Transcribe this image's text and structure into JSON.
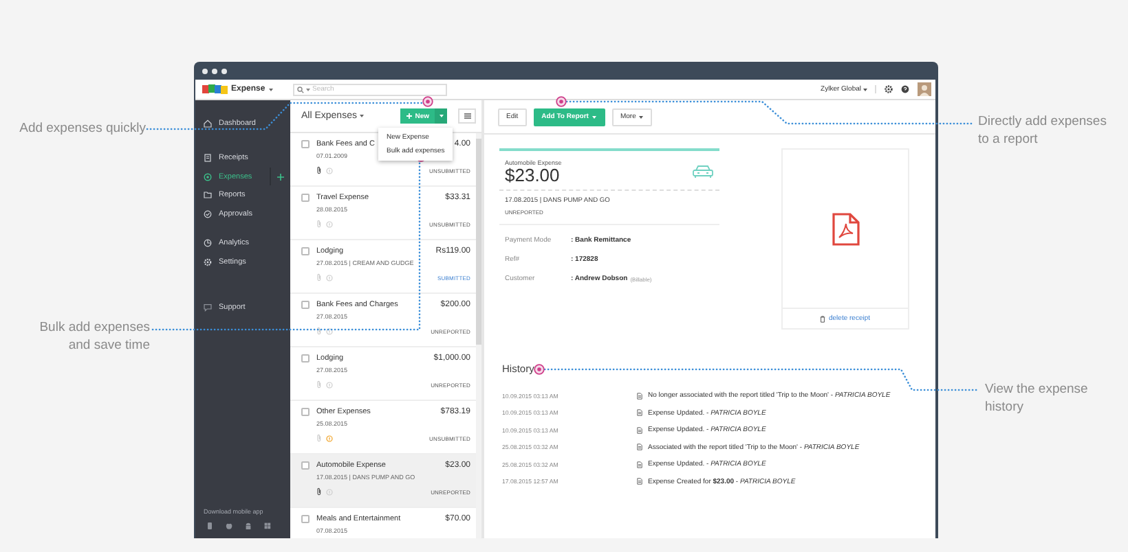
{
  "window": {
    "app_name": "Expense"
  },
  "topbar": {
    "search": {
      "placeholder": "Search"
    },
    "organization": "Zylker Global"
  },
  "sidebar": {
    "sections": [
      [
        {
          "label": "Dashboard",
          "selected": false
        }
      ],
      [
        {
          "label": "Receipts",
          "selected": false
        },
        {
          "label": "Expenses",
          "selected": true,
          "add_button": true
        },
        {
          "label": "Reports",
          "selected": false
        },
        {
          "label": "Approvals",
          "selected": false
        }
      ],
      [
        {
          "label": "Analytics",
          "selected": false
        },
        {
          "label": "Settings",
          "selected": false
        }
      ],
      [
        {
          "label": "Support",
          "selected": false
        }
      ]
    ],
    "footer": "Download mobile app"
  },
  "list": {
    "title": "All Expenses",
    "new_button": "New",
    "menu": [
      "New Expense",
      "Bulk add expenses"
    ],
    "items": [
      {
        "title": "Bank Fees and C",
        "meta": "07.01.2009",
        "amount": "4.00",
        "status": "UNSUBMITTED",
        "submitted": false,
        "checked": false,
        "attached": true,
        "flagged": false,
        "selected": false
      },
      {
        "title": "Travel Expense",
        "meta": "28.08.2015",
        "amount": "$33.31",
        "status": "UNSUBMITTED",
        "submitted": false,
        "checked": false,
        "attached": false,
        "flagged": false,
        "selected": false
      },
      {
        "title": "Lodging",
        "meta": "27.08.2015  |  CREAM AND GUDGE",
        "amount": "Rs119.00",
        "status": "SUBMITTED",
        "submitted": true,
        "checked": false,
        "attached": false,
        "flagged": false,
        "selected": false
      },
      {
        "title": "Bank Fees and Charges",
        "meta": "27.08.2015",
        "amount": "$200.00",
        "status": "UNREPORTED",
        "submitted": false,
        "checked": false,
        "attached": false,
        "flagged": false,
        "selected": false
      },
      {
        "title": "Lodging",
        "meta": "27.08.2015",
        "amount": "$1,000.00",
        "status": "UNREPORTED",
        "submitted": false,
        "checked": false,
        "attached": false,
        "flagged": false,
        "selected": false
      },
      {
        "title": "Other Expenses",
        "meta": "25.08.2015",
        "amount": "$783.19",
        "status": "UNSUBMITTED",
        "submitted": false,
        "checked": false,
        "attached": false,
        "flagged": true,
        "selected": false
      },
      {
        "title": "Automobile Expense",
        "meta": "17.08.2015  |  DANS PUMP AND GO",
        "amount": "$23.00",
        "status": "UNREPORTED",
        "submitted": false,
        "checked": false,
        "attached": true,
        "flagged": false,
        "selected": true
      },
      {
        "title": "Meals and Entertainment",
        "meta": "07.08.2015",
        "amount": "$70.00",
        "checked": false,
        "selected": false
      }
    ]
  },
  "detail": {
    "toolbar": [
      {
        "label": "Edit",
        "kind": "plain"
      },
      {
        "label": "Add To Report",
        "kind": "primary",
        "caret": true
      },
      {
        "label": "More",
        "kind": "plain",
        "caret": true
      }
    ],
    "expense": {
      "category": "Automobile Expense",
      "amount": "$23.00",
      "meta": "17.08.2015  |  DANS PUMP AND GO",
      "status": "UNREPORTED",
      "fields": [
        {
          "label": "Payment Mode",
          "value": ":  Bank Remittance"
        },
        {
          "label": "Ref#",
          "value": ":  172828"
        },
        {
          "label": "Customer",
          "value": ":  Andrew Dobson",
          "note": "(Billable)"
        }
      ]
    },
    "receipt": {
      "action": "delete receipt"
    },
    "history": {
      "title": "History",
      "entries": [
        {
          "time": "10.09.2015 03:13 AM",
          "text": "No longer associated with the report titled 'Trip to the Moon' - *PATRICIA BOYLE*"
        },
        {
          "time": "10.09.2015 03:13 AM",
          "text": "Expense Updated. - *PATRICIA BOYLE*"
        },
        {
          "time": "10.09.2015 03:13 AM",
          "text": "Expense Updated. - *PATRICIA BOYLE*"
        },
        {
          "time": "25.08.2015 03:32 AM",
          "text": "Associated with the report titled 'Trip to the Moon' - *PATRICIA BOYLE*"
        },
        {
          "time": "25.08.2015 03:32 AM",
          "text": "Expense Updated. - *PATRICIA BOYLE*"
        },
        {
          "time": "17.08.2015 12:57 AM",
          "text": "Expense Created for **$23.00** - *PATRICIA BOYLE*"
        }
      ]
    }
  },
  "callouts": [
    {
      "lines": [
        "Add expenses quickly"
      ]
    },
    {
      "lines": [
        "Bulk add expenses",
        "and save time"
      ]
    },
    {
      "lines": [
        "Directly add expenses",
        "to a report"
      ]
    },
    {
      "lines": [
        "View the expense",
        "history"
      ]
    }
  ]
}
